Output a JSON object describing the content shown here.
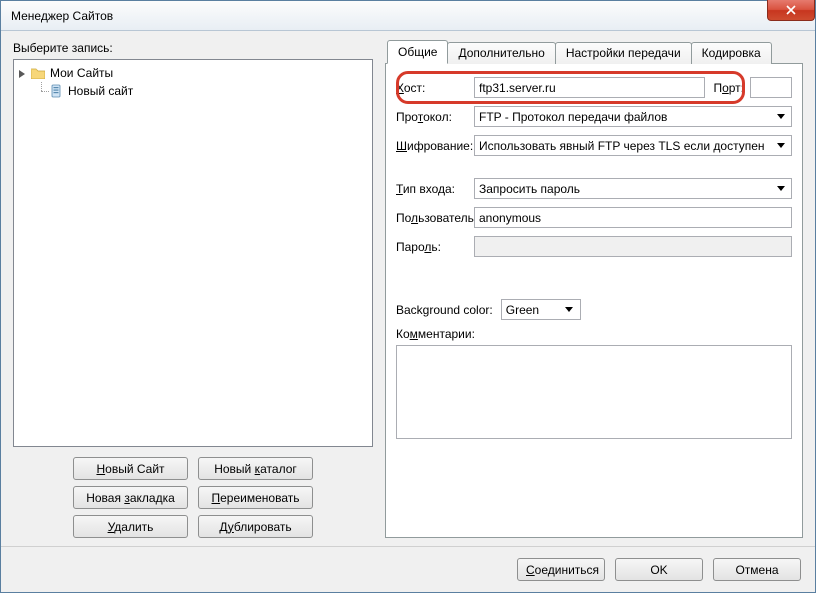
{
  "window": {
    "title": "Менеджер Сайтов"
  },
  "left": {
    "select_label": "Выберите запись:",
    "tree": {
      "root": "Мои Сайты",
      "child": "Новый сайт"
    },
    "buttons": {
      "new_site": "Новый Сайт",
      "new_folder": "Новый каталог",
      "new_bookmark": "Новая закладка",
      "rename": "Переименовать",
      "delete": "Удалить",
      "duplicate": "Дублировать"
    }
  },
  "tabs": {
    "general": "Общие",
    "advanced": "Дополнительно",
    "transfer": "Настройки передачи",
    "charset": "Кодировка"
  },
  "form": {
    "host_label": "Хост:",
    "host_value": "ftp31.server.ru",
    "port_label": "Порт:",
    "port_value": "",
    "protocol_label": "Протокол:",
    "protocol_value": "FTP - Протокол передачи файлов",
    "encryption_label": "Шифрование:",
    "encryption_value": "Использовать явный FTP через TLS если доступен",
    "logon_label": "Тип входа:",
    "logon_value": "Запросить пароль",
    "user_label": "Пользователь:",
    "user_value": "anonymous",
    "password_label": "Пароль:",
    "password_value": "",
    "bgcolor_label": "Background color:",
    "bgcolor_value": "Green",
    "comments_label": "Комментарии:",
    "comments_value": ""
  },
  "footer": {
    "connect": "Соединиться",
    "ok": "OK",
    "cancel": "Отмена"
  }
}
